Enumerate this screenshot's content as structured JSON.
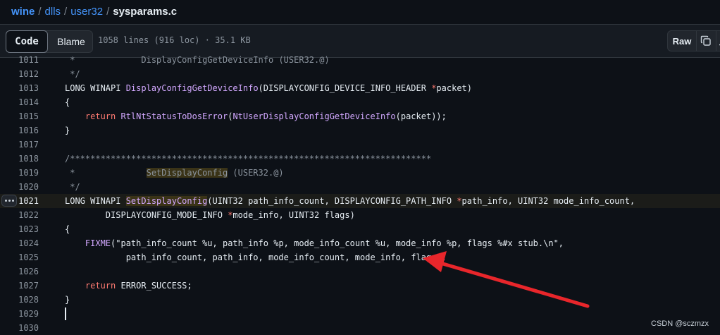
{
  "breadcrumb": {
    "repo": "wine",
    "path1": "dlls",
    "path2": "user32",
    "file": "sysparams.c",
    "sep": "/"
  },
  "toolbar": {
    "code_label": "Code",
    "blame_label": "Blame",
    "file_info": "1058 lines (916 loc) · 35.1 KB",
    "raw_label": "Raw"
  },
  "lines": [
    {
      "n": "1011",
      "t": " *             DisplayConfigGetDeviceInfo (USER32.@)"
    },
    {
      "n": "1012",
      "t": " */"
    },
    {
      "n": "1013",
      "t": "LONG WINAPI DisplayConfigGetDeviceInfo(DISPLAYCONFIG_DEVICE_INFO_HEADER *packet)"
    },
    {
      "n": "1014",
      "t": "{"
    },
    {
      "n": "1015",
      "t": "    return RtlNtStatusToDosError(NtUserDisplayConfigGetDeviceInfo(packet));"
    },
    {
      "n": "1016",
      "t": "}"
    },
    {
      "n": "1017",
      "t": ""
    },
    {
      "n": "1018",
      "t": "/***********************************************************************"
    },
    {
      "n": "1019",
      "t": " *              SetDisplayConfig (USER32.@)"
    },
    {
      "n": "1020",
      "t": " */"
    },
    {
      "n": "1021",
      "t": "LONG WINAPI SetDisplayConfig(UINT32 path_info_count, DISPLAYCONFIG_PATH_INFO *path_info, UINT32 mode_info_count,"
    },
    {
      "n": "1022",
      "t": "        DISPLAYCONFIG_MODE_INFO *mode_info, UINT32 flags)"
    },
    {
      "n": "1023",
      "t": "{"
    },
    {
      "n": "1024",
      "t": "    FIXME(\"path_info_count %u, path_info %p, mode_info_count %u, mode_info %p, flags %#x stub.\\n\","
    },
    {
      "n": "1025",
      "t": "            path_info_count, path_info, mode_info_count, mode_info, flags);"
    },
    {
      "n": "1026",
      "t": ""
    },
    {
      "n": "1027",
      "t": "    return ERROR_SUCCESS;"
    },
    {
      "n": "1028",
      "t": "}"
    },
    {
      "n": "1029",
      "t": ""
    },
    {
      "n": "1030",
      "t": ""
    }
  ],
  "code": {
    "l1011_pre": " *             ",
    "l1011_name": "DisplayConfigGetDeviceInfo",
    "l1011_post": " (USER32.@)",
    "l1013_kw": "LONG WINAPI ",
    "l1013_fn": "DisplayConfigGetDeviceInfo",
    "l1013_rest": "(DISPLAYCONFIG_DEVICE_INFO_HEADER ",
    "l1013_ptr": "*",
    "l1013_end": "packet)",
    "l1015_ret": "return ",
    "l1015_fn1": "RtlNtStatusToDosError",
    "l1015_p": "(",
    "l1015_fn2": "NtUserDisplayConfigGetDeviceInfo",
    "l1015_end": "(packet));",
    "l1019_pre": " *              ",
    "l1019_name": "SetDisplayConfig",
    "l1019_post": " (USER32.@)",
    "l1021_kw": "LONG WINAPI ",
    "l1021_fn": "SetDisplayConfig",
    "l1021_a": "(UINT32 path_info_count, DISPLAYCONFIG_PATH_INFO ",
    "l1021_ptr": "*",
    "l1021_b": "path_info, UINT32 mode_info_count,",
    "l1022_a": "        DISPLAYCONFIG_MODE_INFO ",
    "l1022_ptr": "*",
    "l1022_b": "mode_info, UINT32 flags)",
    "l1024_fn": "FIXME",
    "l1024_rest": "(\"path_info_count %u, path_info %p, mode_info_count %u, mode_info %p, flags %#x stub.\\n\",",
    "l1027_ret": "return ",
    "l1027_val": "ERROR_SUCCESS;"
  },
  "watermark": "CSDN @sczmzx",
  "colors": {
    "arrow": "#e8262b",
    "link": "#4493f8",
    "bg": "#0d1117"
  }
}
